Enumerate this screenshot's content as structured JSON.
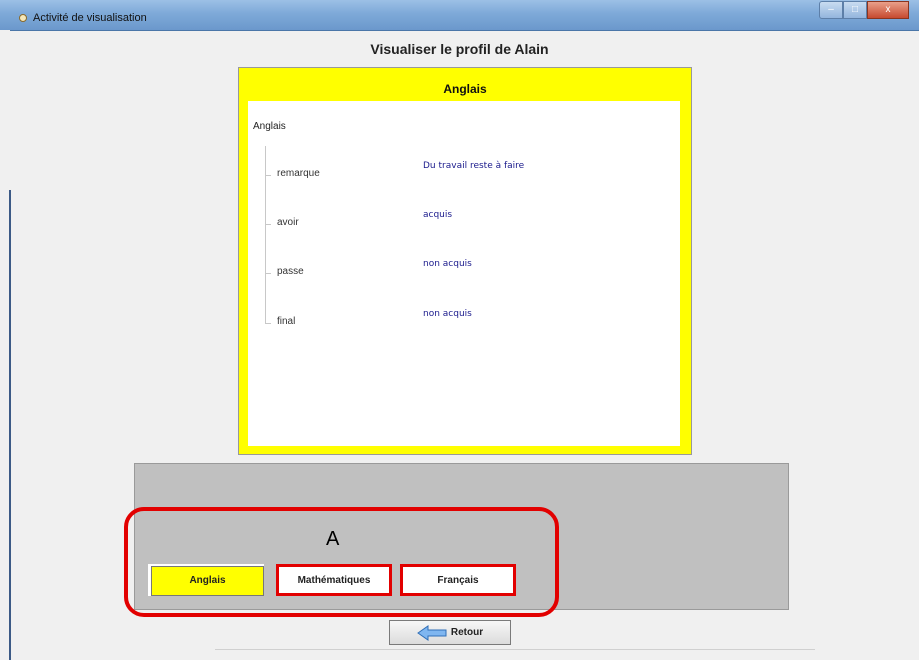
{
  "window": {
    "title": "Activité de visualisation",
    "controls": {
      "minimize": "–",
      "maximize": "□",
      "close": "x"
    }
  },
  "page": {
    "heading": "Visualiser le profil de Alain"
  },
  "profile_panel": {
    "title": "Anglais",
    "tree_root": "Anglais",
    "rows": [
      {
        "key": "remarque",
        "value": "Du travail reste à faire"
      },
      {
        "key": "avoir",
        "value": "acquis"
      },
      {
        "key": "passe",
        "value": "non acquis"
      },
      {
        "key": "final",
        "value": "non acquis"
      }
    ]
  },
  "annotation": {
    "label": "A",
    "color": "#e20000"
  },
  "subject_tabs": [
    {
      "label": "Anglais",
      "selected": true
    },
    {
      "label": "Mathématiques",
      "selected": false
    },
    {
      "label": "Français",
      "selected": false
    }
  ],
  "footer": {
    "back_label": "Retour",
    "back_icon": "left-arrow-icon"
  },
  "colors": {
    "panel_yellow": "#ffff00",
    "value_text": "#1a1a8c",
    "highlight_red": "#e20000"
  }
}
